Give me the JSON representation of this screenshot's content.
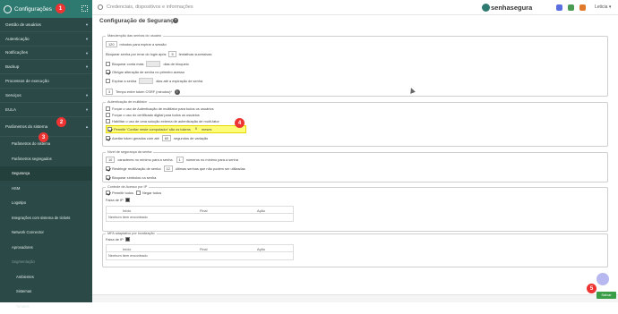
{
  "sidebar": {
    "title": "Configurações",
    "items": [
      {
        "label": "Gestão de usuários"
      },
      {
        "label": "Autenticação"
      },
      {
        "label": "Notificações"
      },
      {
        "label": "Backup"
      },
      {
        "label": "Processos de execução"
      },
      {
        "label": "Serviços"
      },
      {
        "label": "EULA"
      }
    ],
    "group_label": "Parâmetros do sistema",
    "subitems": [
      {
        "label": "Parâmetros do sistema"
      },
      {
        "label": "Parâmetros segregados"
      },
      {
        "label": "Segurança"
      },
      {
        "label": "HSM"
      },
      {
        "label": "Logotipo"
      },
      {
        "label": "Integrações com sistema de tickets"
      },
      {
        "label": "Network Connector"
      },
      {
        "label": "Aprovadores"
      },
      {
        "label": "Segmentação"
      }
    ],
    "subsub": [
      {
        "label": "Ambientes"
      },
      {
        "label": "Sistemas"
      },
      {
        "label": "Tenants"
      }
    ]
  },
  "badges": {
    "b1": "1",
    "b2": "2",
    "b3": "3",
    "b4": "4",
    "b5": "5"
  },
  "topbar": {
    "search_placeholder": "Credenciais, dispositivos e informações",
    "brand": "senhasegura",
    "user": "Leticia ▾"
  },
  "page": {
    "title": "Configuração de Segurança",
    "help": "?"
  },
  "section1": {
    "legend": "Manutenção das senhas do usuário",
    "expire_value": "120",
    "expire_label": "minutos para expirar a sessão",
    "block_pre": "Bloquear senha por errar do login após",
    "block_value": "5",
    "block_post": "tentativas sucessivas",
    "block_older_pre": "Bloquear conta mais",
    "block_older_post": "dias de bloqueio",
    "force_change_label": "Obrigar alteração de senha no primeiro acesso",
    "expire_pwd_pre": "Expirar a senha",
    "expire_pwd_post": "dias até a expiração de senha",
    "token_value": "3",
    "token_label": "Tempo entre token CSRF (minutos)*"
  },
  "section2": {
    "legend": "Autenticação de multifator",
    "opt1": "Forçar o uso de Autenticação de multifator para todos os usuários",
    "opt2": "Forçar o uso do certificado digital para todos os usuários",
    "opt3": "Habilitar o uso de uma solução externa de autenticação de multi-fator",
    "opt4_pre": "Permitir 'Confiar neste computador' são os tokens",
    "opt4_value": "0",
    "opt4_post": "meses",
    "opt5_pre": "Aceitar token gerados com até",
    "opt5_value": "60",
    "opt5_post": "segundos de variação"
  },
  "section3": {
    "legend": "Nível de segurança da senha",
    "chars_value": "10",
    "chars_label": "caracteres no mínimo para a senha",
    "numbers_value": "1",
    "numbers_label": "números no mínimo para a senha",
    "restrict_pre": "Restringir reutilização de senha",
    "restrict_value": "12",
    "restrict_post": "últimas senhas que não podem ser utilizadas",
    "ambiguous_label": "Bloquear símbolos na senha"
  },
  "section4": {
    "legend": "Controle de Acesso por IP",
    "allow_all": "Permitir todos",
    "deny_all": "Negar todos",
    "ip_range_label": "Faixa de IP",
    "columns": [
      "Início",
      "Final",
      "Ação"
    ],
    "empty": "Nenhum item encontrado"
  },
  "section5": {
    "legend": "MFA adaptativo por localização",
    "ip_range_label": "Faixa de IP",
    "columns": [
      "Início",
      "Final",
      "Ação"
    ],
    "empty": "Nenhum item encontrado"
  },
  "save_label": "Salvar"
}
